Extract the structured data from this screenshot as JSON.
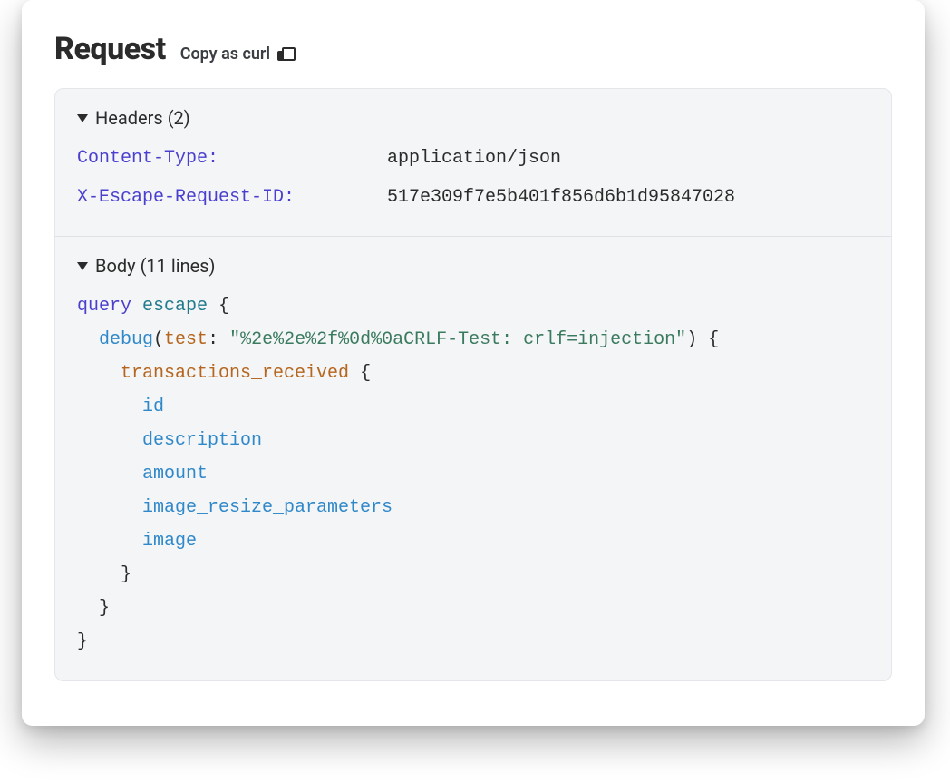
{
  "title": "Request",
  "copy_as_curl_label": "Copy as curl",
  "headers_section": {
    "label": "Headers (2)",
    "rows": [
      {
        "key": "Content-Type:",
        "value": "application/json"
      },
      {
        "key": "X-Escape-Request-ID:",
        "value": "517e309f7e5b401f856d6b1d95847028"
      }
    ]
  },
  "body_section": {
    "label": "Body (11 lines)",
    "code": {
      "keyword": "query",
      "operation": "escape",
      "field_debug": "debug",
      "arg_name": "test",
      "arg_value": "\"%2e%2e%2f%0d%0aCRLF-Test: crlf=injection\"",
      "sub_selection": "transactions_received",
      "fields": [
        "id",
        "description",
        "amount",
        "image_resize_parameters",
        "image"
      ]
    }
  }
}
